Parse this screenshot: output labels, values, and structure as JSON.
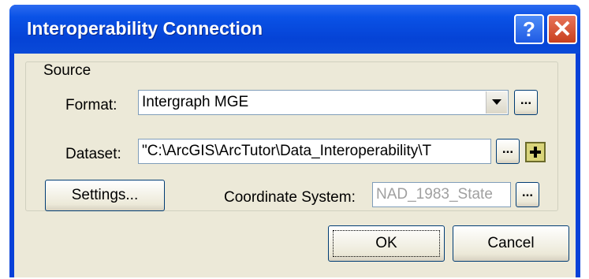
{
  "window": {
    "title": "Interoperability Connection"
  },
  "titlebar": {
    "help_label": "?",
    "close_label": "✕"
  },
  "source": {
    "legend": "Source",
    "format_label": "Format:",
    "format_value": "Intergraph MGE",
    "dataset_label": "Dataset:",
    "dataset_value": "\"C:\\ArcGIS\\ArcTutor\\Data_Interoperability\\T",
    "browse_label": "...",
    "settings_label": "Settings...",
    "coord_label": "Coordinate System:",
    "coord_value": "NAD_1983_State"
  },
  "footer": {
    "ok_label": "OK",
    "cancel_label": "Cancel"
  },
  "icons": [
    "help-icon",
    "close-icon",
    "chevron-down-icon",
    "add-icon"
  ]
}
